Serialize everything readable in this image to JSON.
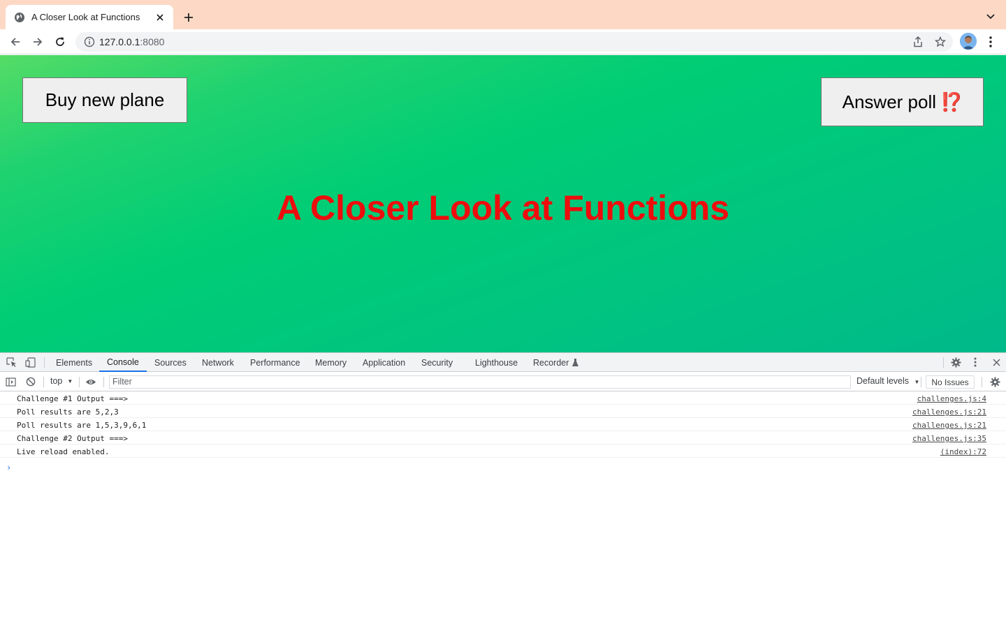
{
  "browser": {
    "tab_title": "A Closer Look at Functions",
    "url_host": "127.0.0.1",
    "url_port": ":8080"
  },
  "page": {
    "buy_button": "Buy new plane",
    "poll_button": "Answer poll",
    "poll_emoji": "⁉️",
    "headline": "A Closer Look at Functions",
    "colors": {
      "headline": "#ee0d0d",
      "gradient_start": "#55dc66",
      "gradient_end": "#00b98a"
    }
  },
  "devtools": {
    "tabs": [
      "Elements",
      "Console",
      "Sources",
      "Network",
      "Performance",
      "Memory",
      "Application",
      "Security",
      "Lighthouse",
      "Recorder"
    ],
    "active_tab": "Console",
    "context": "top",
    "filter_placeholder": "Filter",
    "levels": "Default levels",
    "issues": "No Issues",
    "logs": [
      {
        "message": "Challenge #1 Output ===>",
        "source": "challenges.js:4"
      },
      {
        "message": "Poll results are 5,2,3",
        "source": "challenges.js:21"
      },
      {
        "message": "Poll results are 1,5,3,9,6,1",
        "source": "challenges.js:21"
      },
      {
        "message": "Challenge #2 Output ===>",
        "source": "challenges.js:35"
      },
      {
        "message": "Live reload enabled.",
        "source": "(index):72"
      }
    ],
    "prompt": "›"
  }
}
